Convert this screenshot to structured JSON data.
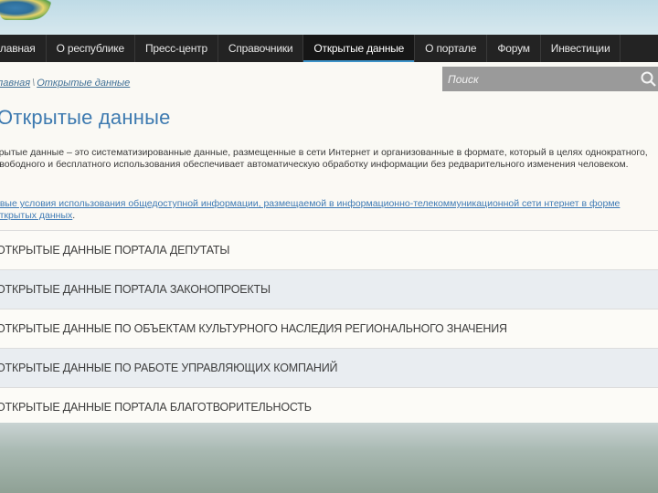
{
  "nav": {
    "items": [
      {
        "label": "главная",
        "active": false
      },
      {
        "label": "О республике",
        "active": false
      },
      {
        "label": "Пресс-центр",
        "active": false
      },
      {
        "label": "Справочники",
        "active": false
      },
      {
        "label": "Открытые данные",
        "active": true
      },
      {
        "label": "О портале",
        "active": false
      },
      {
        "label": "Форум",
        "active": false
      },
      {
        "label": "Инвестиции",
        "active": false
      }
    ]
  },
  "search": {
    "placeholder": "Поиск",
    "icon": "search-icon"
  },
  "breadcrumb": {
    "home": "лавная",
    "separator": "\\",
    "current": "Открытые данные"
  },
  "page": {
    "title": "Открытые данные",
    "description": "крытые данные – это систематизированные данные, размещенные в сети Интернет и организованные в формате, который в целях однократного, свободного и бесплатного использования обеспечивает автоматическую обработку информации без редварительного изменения человеком.",
    "terms_link": "овые условия использования общедоступной информации, размещаемой в информационно-телекоммуникационной сети нтернет в форме открытых данных",
    "terms_end": "."
  },
  "datasets": [
    "ОТКРЫТЫЕ ДАННЫЕ ПОРТАЛА ДЕПУТАТЫ",
    "ОТКРЫТЫЕ ДАННЫЕ ПОРТАЛА ЗАКОНОПРОЕКТЫ",
    "ОТКРЫТЫЕ ДАННЫЕ ПО ОБЪЕКТАМ КУЛЬТУРНОГО НАСЛЕДИЯ РЕГИОНАЛЬНОГО ЗНАЧЕНИЯ",
    "ОТКРЫТЫЕ ДАННЫЕ ПО РАБОТЕ УПРАВЛЯЮЩИХ КОМПАНИЙ",
    "ОТКРЫТЫЕ ДАННЫЕ ПОРТАЛА БЛАГОТВОРИТЕЛЬНОСТЬ"
  ],
  "colors": {
    "accent": "#3d7ab0",
    "nav_bg": "#232323",
    "active_underline": "#3d93c9"
  }
}
